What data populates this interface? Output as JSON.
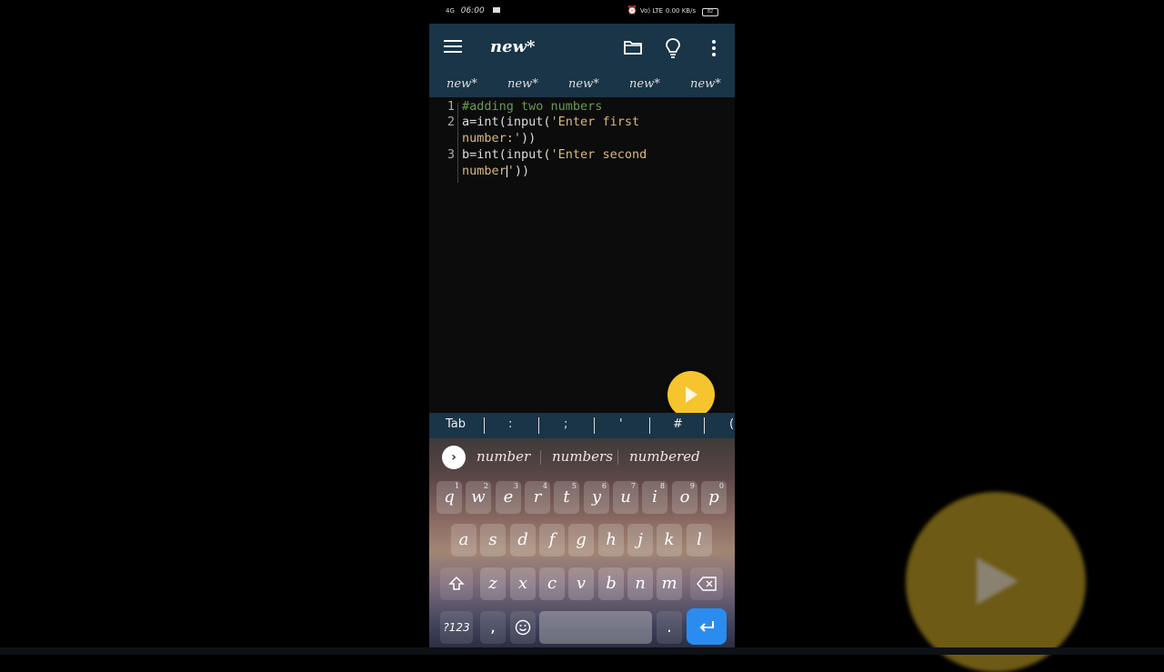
{
  "status_bar": {
    "network": "4G",
    "time": "06:00",
    "volte": "Vo) LTE",
    "data_rate": "0.00 KB/s",
    "battery": "82"
  },
  "app_bar": {
    "title": "new*"
  },
  "tabs": [
    "new*",
    "new*",
    "new*",
    "new*",
    "new*"
  ],
  "editor": {
    "lines": [
      {
        "num": "1",
        "text": "#adding two numbers"
      },
      {
        "num": "2",
        "text_prefix": "a=int(input(",
        "text_string": "'Enter first",
        "text_cont": "number:'",
        "text_suffix": "))"
      },
      {
        "num": "3",
        "text_prefix": "b=int(input(",
        "text_string": "'Enter second",
        "text_cont_before_caret": "number",
        "text_cont_after_caret": "'",
        "text_suffix": "))"
      }
    ]
  },
  "symbol_bar": [
    "Tab",
    ":",
    ";",
    "'",
    "#",
    "("
  ],
  "suggestions": [
    "number",
    "numbers",
    "numbered"
  ],
  "keyboard": {
    "row1": [
      {
        "key": "q",
        "hint": "1"
      },
      {
        "key": "w",
        "hint": "2"
      },
      {
        "key": "e",
        "hint": "3"
      },
      {
        "key": "r",
        "hint": "4"
      },
      {
        "key": "t",
        "hint": "5"
      },
      {
        "key": "y",
        "hint": "6"
      },
      {
        "key": "u",
        "hint": "7"
      },
      {
        "key": "i",
        "hint": "8"
      },
      {
        "key": "o",
        "hint": "9"
      },
      {
        "key": "p",
        "hint": "0"
      }
    ],
    "row2": [
      "a",
      "s",
      "d",
      "f",
      "g",
      "h",
      "j",
      "k",
      "l"
    ],
    "row3": [
      "z",
      "x",
      "c",
      "v",
      "b",
      "n",
      "m"
    ],
    "row4": {
      "symbols": "?123",
      "comma": ",",
      "period": "."
    }
  },
  "icons": {
    "menu": "menu-icon",
    "folder": "folder-icon",
    "bulb": "lightbulb-icon",
    "more": "more-vert-icon",
    "run": "play-icon",
    "shift": "shift-icon",
    "backspace": "backspace-icon",
    "emoji": "emoji-icon",
    "enter": "enter-icon",
    "suggest_expand": "chevron-right-icon"
  },
  "colors": {
    "app_bar": "#1a3448",
    "fab": "#f6c42c",
    "comment": "#6a9955",
    "string": "#d7ba7d",
    "enter_key": "#2b8cf0"
  }
}
